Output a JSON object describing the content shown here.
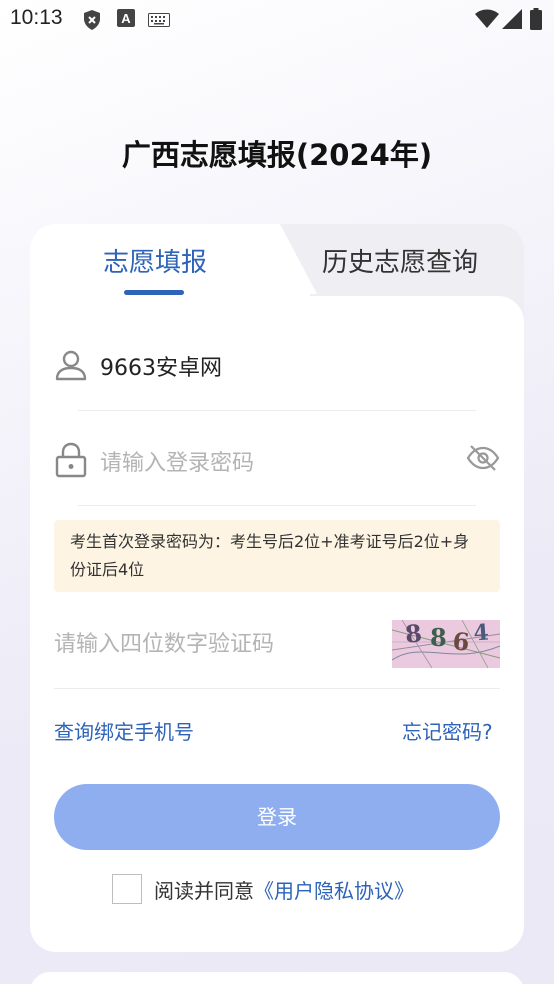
{
  "status_bar": {
    "time": "10:13",
    "icons": [
      "shield-x-icon",
      "font-a-icon",
      "keyboard-icon",
      "wifi-icon",
      "signal-icon",
      "battery-icon"
    ]
  },
  "app": {
    "title": "广西志愿填报(2024年)"
  },
  "tabs": [
    {
      "label": "志愿填报",
      "active": true
    },
    {
      "label": "历史志愿查询",
      "active": false
    }
  ],
  "form": {
    "username_value": "9663安卓网",
    "password_placeholder": "请输入登录密码",
    "notice": "考生首次登录密码为：考生号后2位+准考证号后2位+身份证后4位",
    "captcha_placeholder": "请输入四位数字验证码",
    "captcha_code": "8864",
    "bind_phone_link": "查询绑定手机号",
    "forgot_link": "忘记密码?",
    "login_label": "登录",
    "agree_prefix": "阅读并同意",
    "agree_link": "《用户隐私协议》"
  },
  "colors": {
    "accent": "#2d63b8",
    "button": "#8eaef0",
    "notice_bg": "#fdf4e3"
  }
}
